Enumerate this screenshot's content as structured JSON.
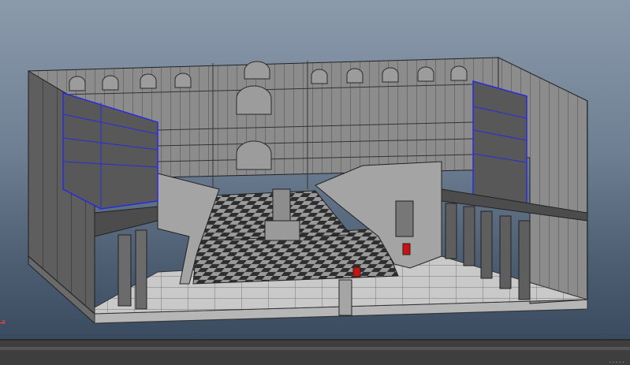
{
  "app": {
    "axis_label": "x",
    "timeline_handle": "....."
  },
  "scene": {
    "wall_color": "#8a8a8a",
    "dark_wall_color": "#5d5d5d",
    "floor_color": "#c7c7c7",
    "selection_color": "#2a2ae0",
    "marker_color": "#cc1111"
  }
}
